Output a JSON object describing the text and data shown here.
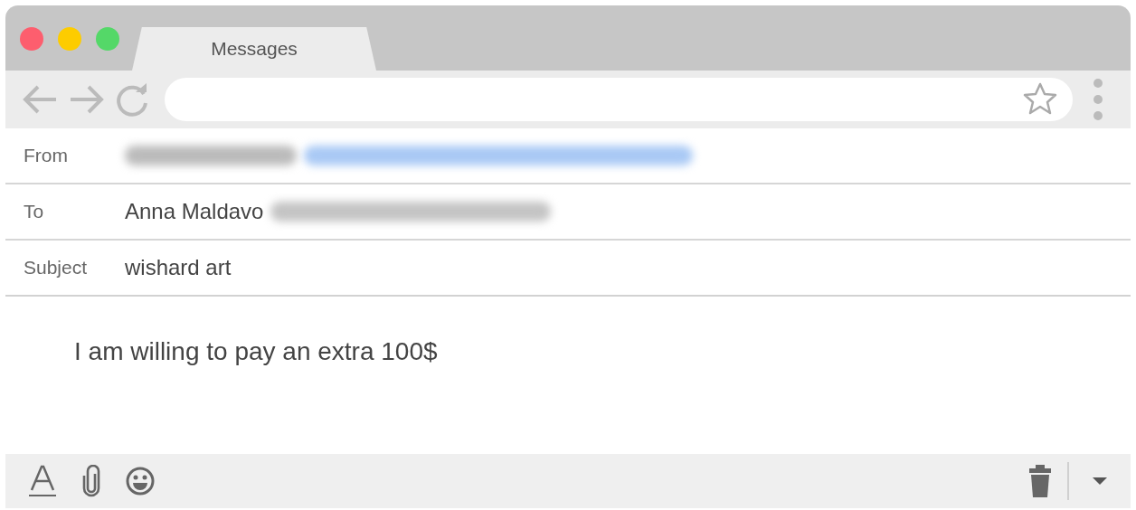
{
  "window": {
    "tab_title": "Messages"
  },
  "fields": [
    {
      "kind": "from",
      "label": "From",
      "blurred": true
    },
    {
      "kind": "to",
      "label": "To",
      "value": "Anna Maldavo",
      "blurred": true
    },
    {
      "kind": "subject",
      "label": "Subject",
      "value": "wishard art",
      "blurred": false
    }
  ],
  "body": "I am willing to pay an extra 100$"
}
